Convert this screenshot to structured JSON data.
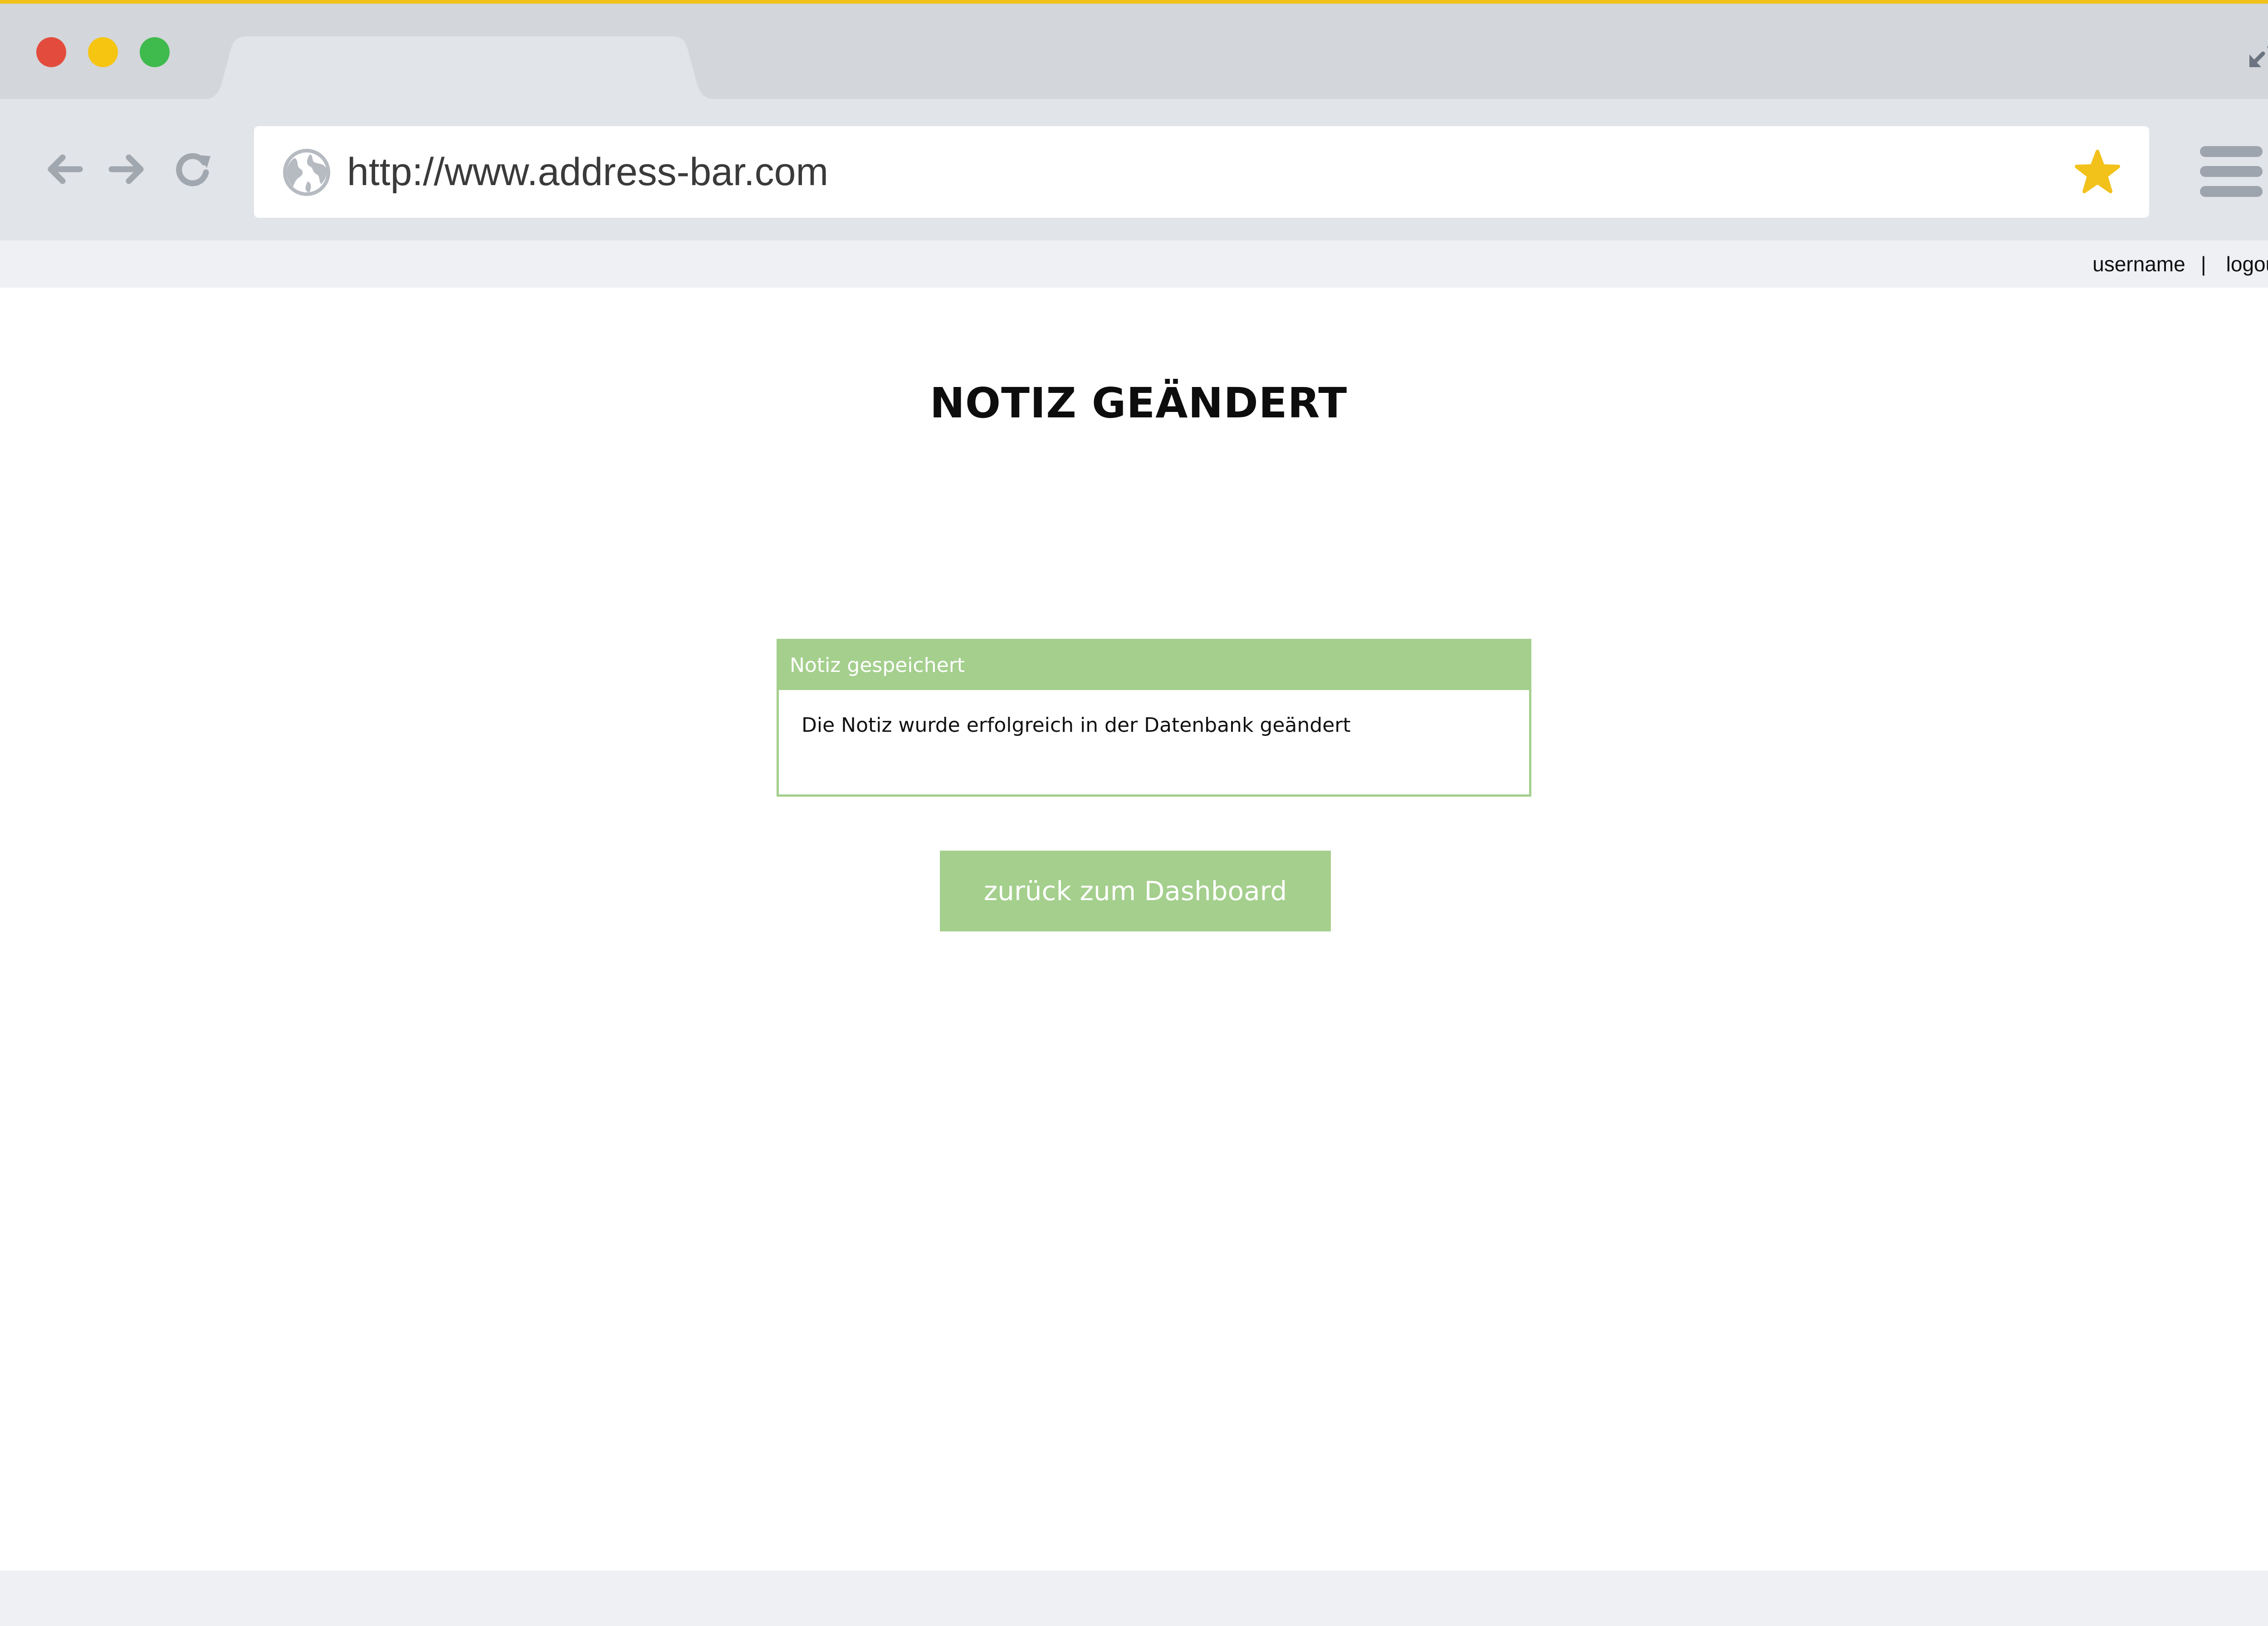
{
  "browser": {
    "address_bar": {
      "url": "http://www.address-bar.com"
    },
    "colors": {
      "close": "#e34c3d",
      "minimize": "#f6c512",
      "maximize": "#3fba4d",
      "bookmark_star": "#f2c21b",
      "chrome_frame": "#d3d6da",
      "toolbar": "#e1e4e8"
    },
    "icons": {
      "back": "arrow-left-icon",
      "forward": "arrow-right-icon",
      "reload": "reload-icon",
      "site": "globe-icon",
      "bookmark": "star-icon",
      "menu": "hamburger-menu-icon",
      "fullscreen": "fullscreen-icon"
    }
  },
  "userbar": {
    "username": "username",
    "separator": "|",
    "logout": "logout"
  },
  "page": {
    "title": "NOTIZ GEÄNDERT",
    "alert": {
      "header": "Notiz gespeichert",
      "message": "Die Notiz wurde erfolgreich in der Datenbank geändert"
    },
    "back_button_label": "zurück zum Dashboard",
    "accent_color": "#a4cf8d"
  }
}
